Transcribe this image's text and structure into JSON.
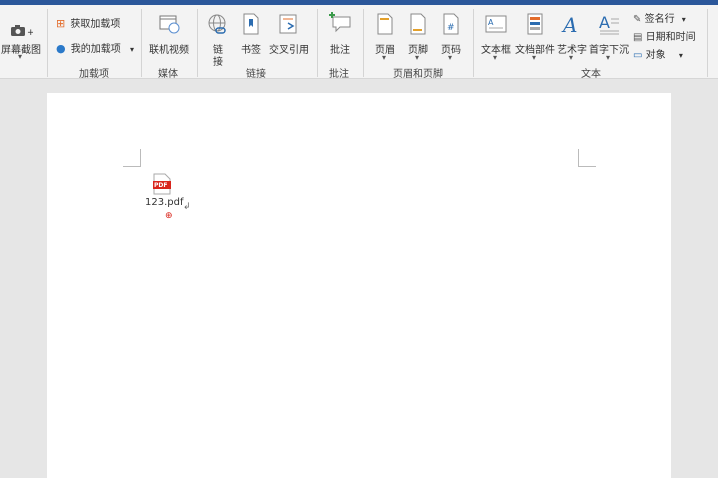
{
  "ribbon": {
    "screenshot": "屏幕截图",
    "get_addins": "获取加载项",
    "my_addins": "我的加载项",
    "addins_group": "加载项",
    "online_video": "联机视频",
    "media_group": "媒体",
    "link_line1": "链",
    "link_line2": "接",
    "bookmark": "书签",
    "cross_ref": "交叉引用",
    "links_group": "链接",
    "comment": "批注",
    "comments_group": "批注",
    "header": "页眉",
    "footer": "页脚",
    "page_number": "页码",
    "header_footer_group": "页眉和页脚",
    "textbox": "文本框",
    "quick_parts": "文档部件",
    "wordart": "艺术字",
    "dropcap": "首字下沉",
    "signature_line": "签名行",
    "date_time": "日期和时间",
    "object": "对象",
    "text_group": "文本"
  },
  "document": {
    "attachment_name": "123.pdf",
    "pdf_badge": "PDF"
  },
  "colors": {
    "accent": "#2b579a",
    "pdf_red": "#d9251c"
  }
}
